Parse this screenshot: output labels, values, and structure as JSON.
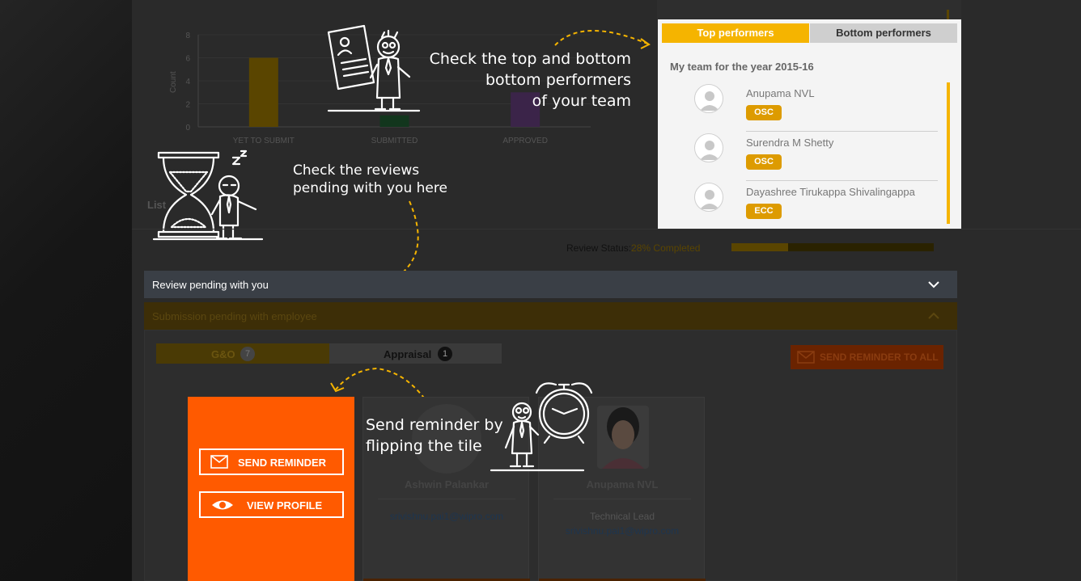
{
  "chart_data": {
    "type": "bar",
    "categories": [
      "YET TO SUBMIT",
      "SUBMITTED",
      "APPROVED"
    ],
    "values": [
      6,
      1,
      3
    ],
    "ylabel": "Count",
    "ylim": [
      0,
      8
    ],
    "yticks": [
      "0",
      "2",
      "4",
      "6",
      "8"
    ],
    "colors": [
      "#5a4500",
      "#12361d",
      "#3b2449"
    ]
  },
  "callouts": {
    "performers": [
      "Check the top and bottom",
      "bottom performers",
      "of your team"
    ],
    "reviews": [
      "Check the reviews",
      "pending with you here"
    ],
    "reminder": [
      "Send reminder by",
      "flipping the tile"
    ]
  },
  "performers_panel": {
    "tab_top": "Top performers",
    "tab_bottom": "Bottom performers",
    "title": "My team for the year 2015-16",
    "people": [
      {
        "name": "Anupama NVL",
        "badge": "OSC"
      },
      {
        "name": "Surendra M Shetty",
        "badge": "OSC"
      },
      {
        "name": "Dayashree Tirukappa Shivalingappa",
        "badge": "ECC"
      }
    ]
  },
  "background": {
    "list_heading": "List",
    "review_status_label": "Review Status:",
    "review_status_value": "28% Completed",
    "review_progress": 0.28
  },
  "sections": {
    "review_pending": "Review pending with you",
    "submission_pending": "Submission pending with employee"
  },
  "tabs": {
    "go_label": "G&O",
    "go_count": "7",
    "appraisal_label": "Appraisal",
    "appraisal_count": "1",
    "send_all": "SEND REMINDER TO ALL"
  },
  "flip_tile": {
    "send_reminder": "SEND REMINDER",
    "view_profile": "VIEW PROFILE"
  },
  "tiles": [
    {
      "name": "Ashwin Palankar",
      "role": "",
      "email": "srivishnu.pai1@wipro.com"
    },
    {
      "name": "Anupama NVL",
      "role": "Technical Lead",
      "email": "srivishnu.pai1@wipro.com"
    }
  ],
  "colors": {
    "accent": "#f5b400",
    "orange": "#ff5a00",
    "badge": "#dd9b00"
  }
}
